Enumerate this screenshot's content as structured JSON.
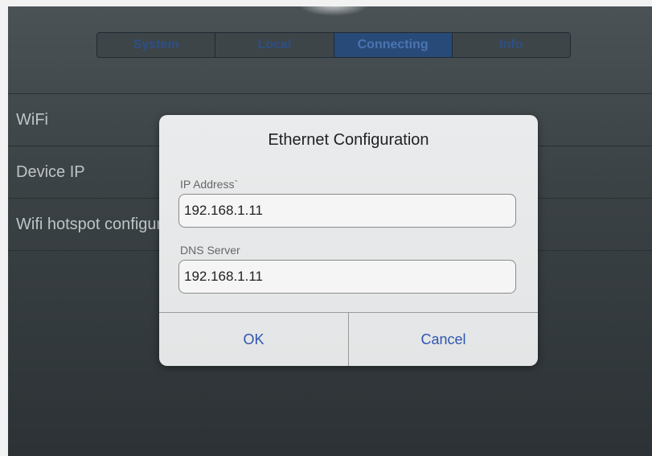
{
  "tabs": [
    "System",
    "Local",
    "Connecting",
    "Info"
  ],
  "rows": [
    "WiFi",
    "Device IP",
    "Wifi hotspot configuration"
  ],
  "dialog": {
    "title": "Ethernet Configuration",
    "ip_label": "IP Address`",
    "ip_value": "192.168.1.11",
    "dns_label": "DNS Server",
    "dns_value": "192.168.1.11",
    "ok_label": "OK",
    "cancel_label": "Cancel"
  },
  "colors": {
    "accent": "#2f56b0",
    "active_tab": "#274a78"
  }
}
